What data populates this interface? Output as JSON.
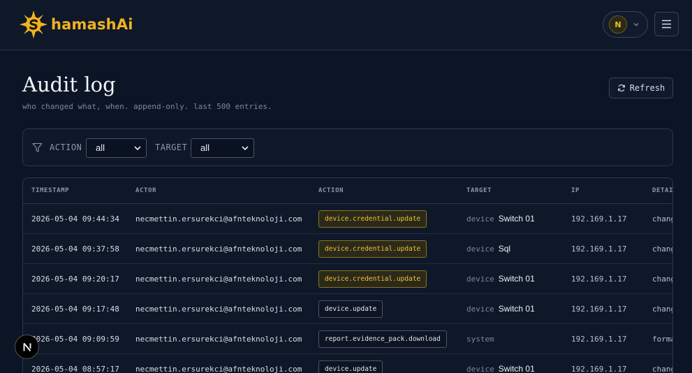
{
  "brand": {
    "name": "hamashAi",
    "accent": "#f1b21f"
  },
  "header": {
    "avatar_initial": "N",
    "menu_icon": "hamburger-icon"
  },
  "page": {
    "title": "Audit log",
    "subtitle": "who changed what, when. append-only. last 500 entries.",
    "refresh_label": "Refresh"
  },
  "filters": {
    "action_label": "ACTION",
    "action_value": "all",
    "target_label": "TARGET",
    "target_value": "all"
  },
  "table": {
    "columns": [
      "TIMESTAMP",
      "ACTOR",
      "ACTION",
      "TARGET",
      "IP",
      "DETAI"
    ],
    "rows": [
      {
        "timestamp": "2026-05-04 09:44:34",
        "actor": "necmettin.ersurekci@afnteknoloji.com",
        "action": "device.credential.update",
        "action_style": "warn",
        "target_type": "device",
        "target_name": "Switch 01",
        "ip": "192.169.1.17",
        "details": "chang"
      },
      {
        "timestamp": "2026-05-04 09:37:58",
        "actor": "necmettin.ersurekci@afnteknoloji.com",
        "action": "device.credential.update",
        "action_style": "warn",
        "target_type": "device",
        "target_name": "Sql",
        "ip": "192.169.1.17",
        "details": "chang"
      },
      {
        "timestamp": "2026-05-04 09:20:17",
        "actor": "necmettin.ersurekci@afnteknoloji.com",
        "action": "device.credential.update",
        "action_style": "warn",
        "target_type": "device",
        "target_name": "Switch 01",
        "ip": "192.169.1.17",
        "details": "chang"
      },
      {
        "timestamp": "2026-05-04 09:17:48",
        "actor": "necmettin.ersurekci@afnteknoloji.com",
        "action": "device.update",
        "action_style": "neutral",
        "target_type": "device",
        "target_name": "Switch 01",
        "ip": "192.169.1.17",
        "details": "chang"
      },
      {
        "timestamp": "2026-05-04 09:09:59",
        "actor": "necmettin.ersurekci@afnteknoloji.com",
        "action": "report.evidence_pack.download",
        "action_style": "neutral",
        "target_type": "system",
        "target_name": "",
        "ip": "192.169.1.17",
        "details": "forma"
      },
      {
        "timestamp": "2026-05-04 08:57:17",
        "actor": "necmettin.ersurekci@afnteknoloji.com",
        "action": "device.update",
        "action_style": "neutral",
        "target_type": "device",
        "target_name": "Switch 01",
        "ip": "192.169.1.17",
        "details": "chang"
      }
    ]
  },
  "floating": {
    "next_badge": "N"
  }
}
